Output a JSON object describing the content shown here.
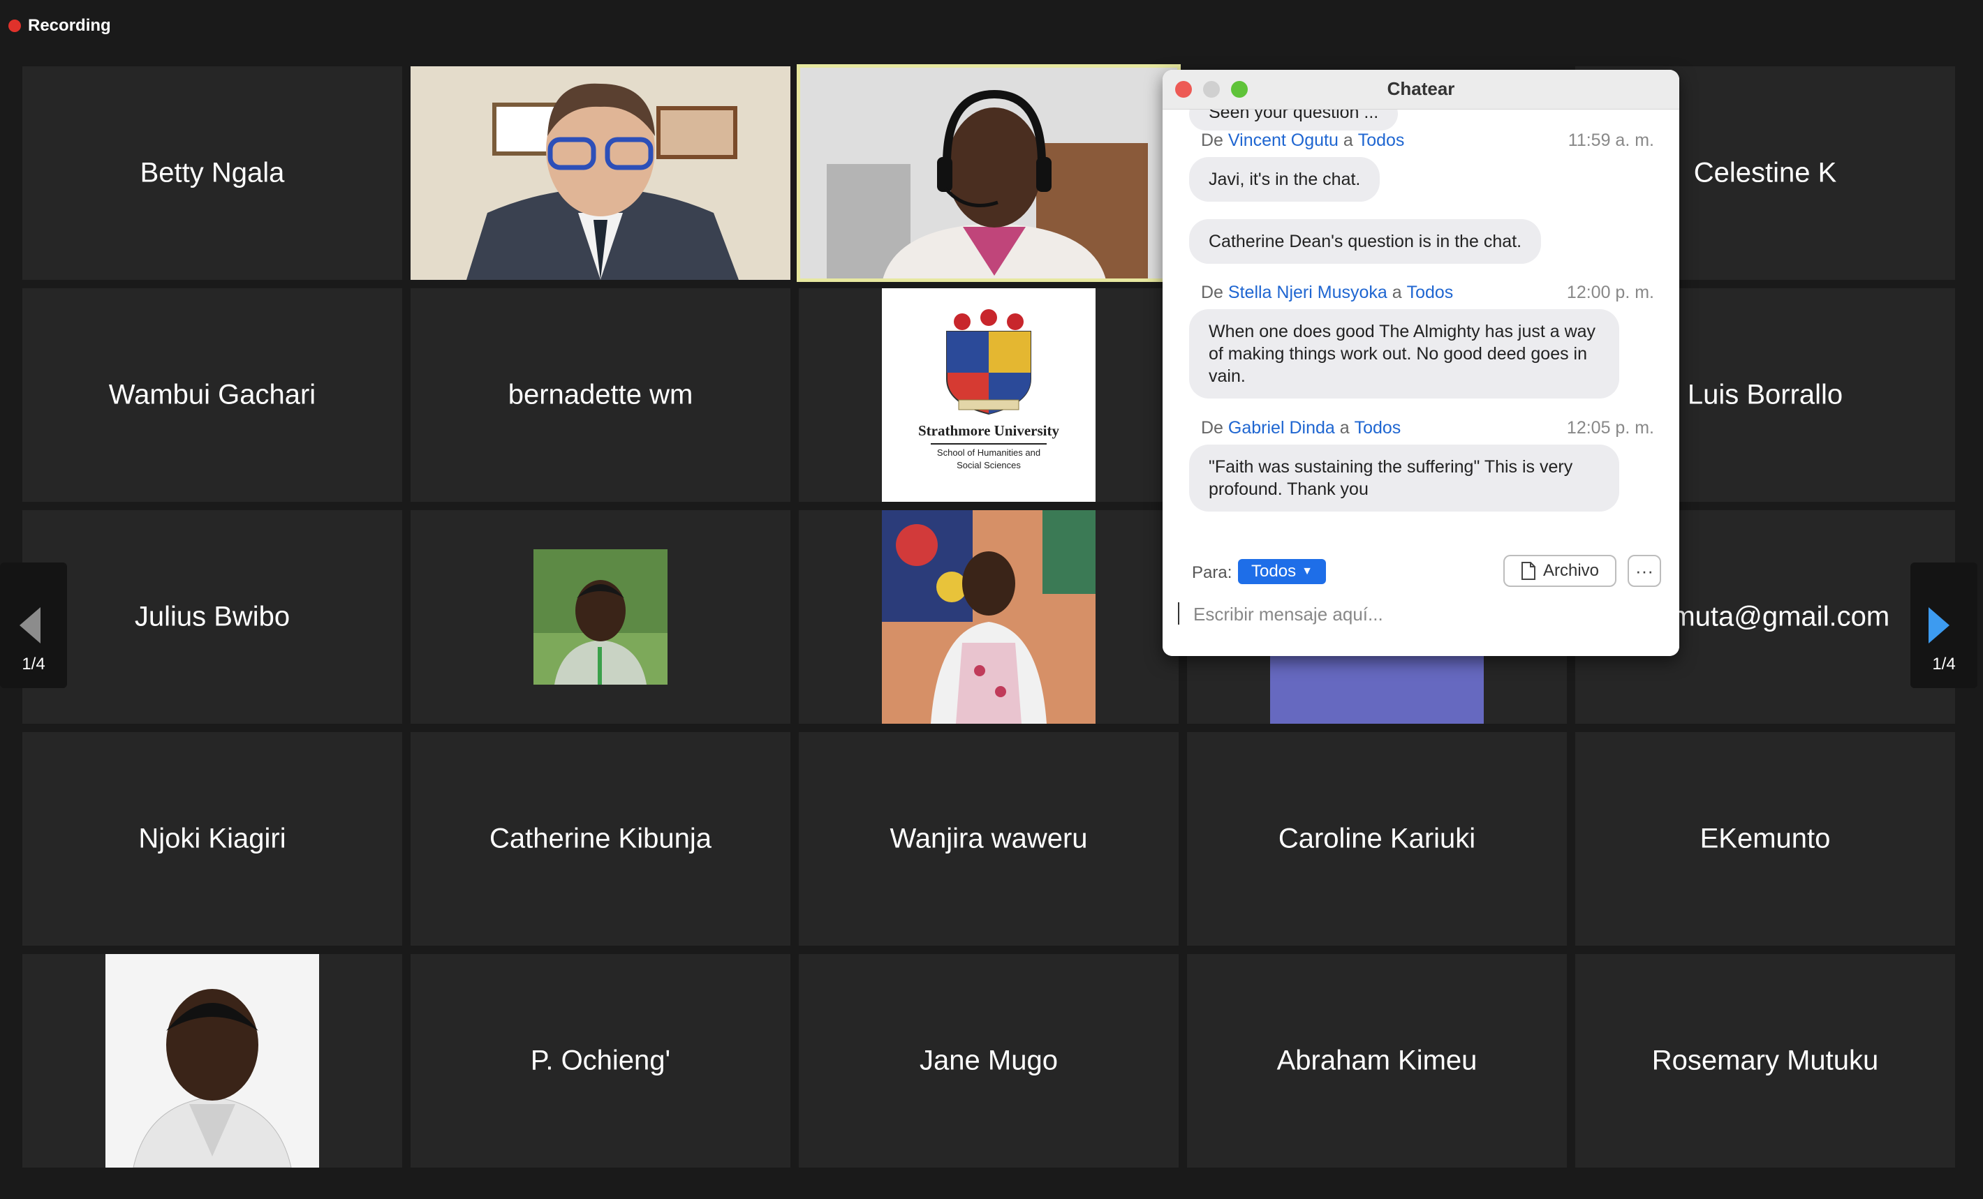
{
  "recording": {
    "label": "Recording"
  },
  "participants": {
    "betty": "Betty Ngala",
    "celestine": "Celestine K",
    "wambui": "Wambui Gachari",
    "bernadette": "bernadette wm",
    "luis": "Luis Borrallo",
    "julius": "Julius Bwibo",
    "gumuta": "gumuta@gmail.com",
    "njoki": "Njoki Kiagiri",
    "catherine": "Catherine Kibunja",
    "wanjira": "Wanjira waweru",
    "caroline": "Caroline Kariuki",
    "ekemunto": "EKemunto",
    "ochieng": "P. Ochieng'",
    "jane": "Jane Mugo",
    "abraham": "Abraham Kimeu",
    "rosemary": "Rosemary Mutuku"
  },
  "strathmore_logo": {
    "name": "Strathmore University",
    "line1": "School of Humanities and",
    "line2": "Social Sciences"
  },
  "navigation": {
    "left_page": "1/4",
    "right_page": "1/4"
  },
  "chat": {
    "title": "Chatear",
    "partial_message": "Seen your question ...",
    "messages": [
      {
        "prefix": "De",
        "sender": "Vincent Ogutu",
        "mid": "a",
        "recipient": "Todos",
        "time": "11:59 a. m.",
        "bubbles": [
          "Javi, it's in the chat.",
          "Catherine Dean's question is in the chat."
        ]
      },
      {
        "prefix": "De",
        "sender": "Stella Njeri Musyoka",
        "mid": "a",
        "recipient": "Todos",
        "time": "12:00 p. m.",
        "bubbles": [
          "When one does good The Almighty has just a way of making things work out. No good deed goes in vain."
        ]
      },
      {
        "prefix": "De",
        "sender": "Gabriel Dinda",
        "mid": "a",
        "recipient": "Todos",
        "time": "12:05 p. m.",
        "bubbles": [
          "\"Faith was sustaining the suffering\" This is very profound. Thank you"
        ]
      }
    ],
    "to_label": "Para:",
    "to_value": "Todos",
    "file_label": "Archivo",
    "more_label": "···",
    "input_placeholder": "Escribir mensaje aquí..."
  },
  "colors": {
    "background": "#1a1a1a",
    "tile": "#262626",
    "active_speaker": "#e7e8a0",
    "accent_blue": "#1e6ee8",
    "record_red": "#e0322b"
  }
}
